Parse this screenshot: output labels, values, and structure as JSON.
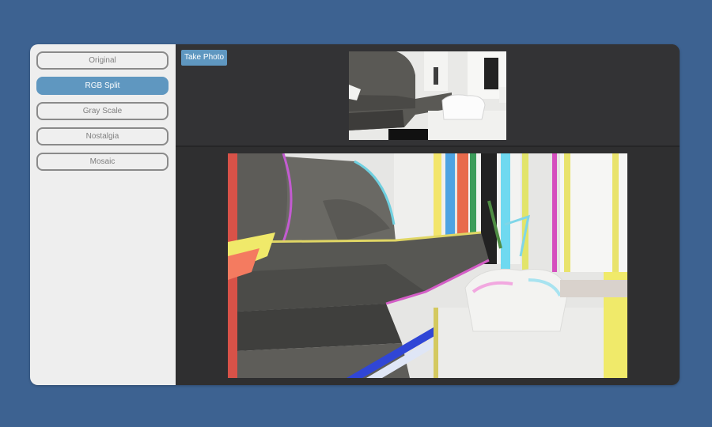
{
  "sidebar": {
    "filters": [
      {
        "label": "Original",
        "active": false
      },
      {
        "label": "RGB Split",
        "active": true
      },
      {
        "label": "Gray Scale",
        "active": false
      },
      {
        "label": "Nostalgia",
        "active": false
      },
      {
        "label": "Mosaic",
        "active": false
      }
    ]
  },
  "toolbar": {
    "take_photo_label": "Take Photo"
  },
  "colors": {
    "background": "#3d6291",
    "accent": "#5f97c0",
    "sidebar": "#eeeeee",
    "panel": "#333335"
  }
}
